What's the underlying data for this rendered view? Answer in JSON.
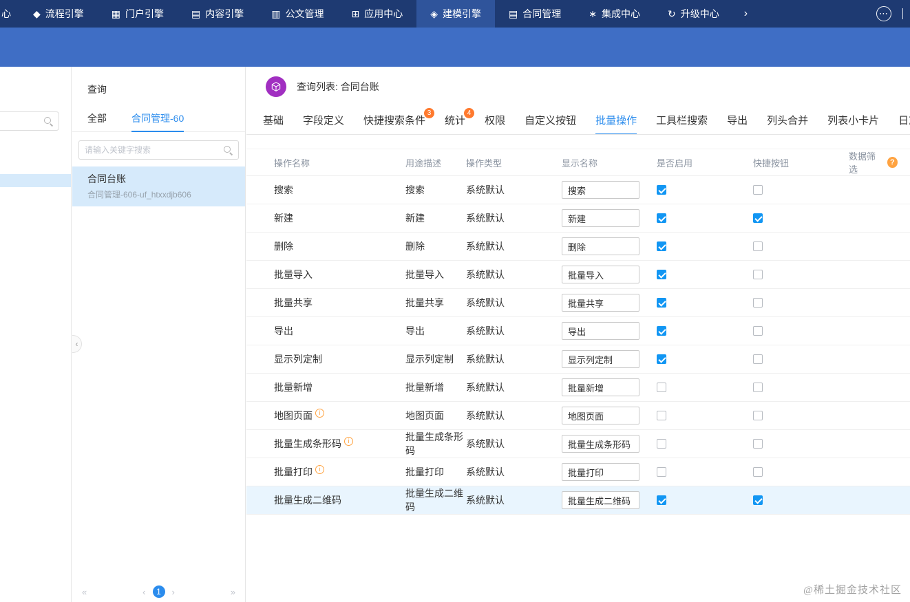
{
  "topnav": {
    "clipped_label": "心",
    "items": [
      {
        "label": "流程引擎",
        "glyph": "◆"
      },
      {
        "label": "门户引擎",
        "glyph": "▦"
      },
      {
        "label": "内容引擎",
        "glyph": "▤"
      },
      {
        "label": "公文管理",
        "glyph": "▥"
      },
      {
        "label": "应用中心",
        "glyph": "⊞"
      },
      {
        "label": "建模引擎",
        "glyph": "◈",
        "active": true
      },
      {
        "label": "合同管理",
        "glyph": "▤"
      },
      {
        "label": "集成中心",
        "glyph": "∗"
      },
      {
        "label": "升级中心",
        "glyph": "↻"
      }
    ]
  },
  "icons": {
    "chevron_right": "›",
    "more": "⋯",
    "collapse": "‹",
    "question": "?",
    "info": "i"
  },
  "colors": {
    "navbar_bg": "#1e3a72",
    "navbar_active_bg": "#2f549b",
    "subbar_bg": "#3f6ec5",
    "accent_blue": "#2b8ced",
    "checkbox_blue": "#1296f3",
    "selected_item_bg": "#d6eafb",
    "row_highlight_bg": "#e9f5fe",
    "badge_orange": "#ff7a2e",
    "info_orange": "#ffa341",
    "cube_purple": "#a12fc1"
  },
  "sidebar": {
    "title": "查询",
    "tabs": [
      {
        "label": "全部"
      },
      {
        "label": "合同管理-60",
        "active": true
      }
    ],
    "search_placeholder": "请输入关键字搜索",
    "items": [
      {
        "title": "合同台账",
        "subtitle": "合同管理-606-uf_htxxdjb606",
        "selected": true
      }
    ],
    "pagination": {
      "first": "«",
      "prev": "‹",
      "current": "1",
      "next": "›",
      "last": "»"
    }
  },
  "main": {
    "header": {
      "title": "查询列表: 合同台账"
    },
    "tabs": [
      {
        "label": "基础"
      },
      {
        "label": "字段定义"
      },
      {
        "label": "快捷搜索条件",
        "badge": "3"
      },
      {
        "label": "统计",
        "badge": "4"
      },
      {
        "label": "权限"
      },
      {
        "label": "自定义按钮"
      },
      {
        "label": "批量操作",
        "active": true
      },
      {
        "label": "工具栏搜索"
      },
      {
        "label": "导出"
      },
      {
        "label": "列头合并"
      },
      {
        "label": "列表小卡片"
      },
      {
        "label": "日志"
      }
    ],
    "table": {
      "headers": [
        "操作名称",
        "用途描述",
        "操作类型",
        "显示名称",
        "是否启用",
        "快捷按钮",
        "数据筛选"
      ],
      "rows": [
        {
          "name": "搜索",
          "desc": "搜索",
          "type": "系统默认",
          "display_name": "搜索",
          "enabled": true,
          "quick": false,
          "info": false,
          "highlighted": false
        },
        {
          "name": "新建",
          "desc": "新建",
          "type": "系统默认",
          "display_name": "新建",
          "enabled": true,
          "quick": true,
          "info": false,
          "highlighted": false
        },
        {
          "name": "删除",
          "desc": "删除",
          "type": "系统默认",
          "display_name": "删除",
          "enabled": true,
          "quick": false,
          "info": false,
          "highlighted": false
        },
        {
          "name": "批量导入",
          "desc": "批量导入",
          "type": "系统默认",
          "display_name": "批量导入",
          "enabled": true,
          "quick": false,
          "info": false,
          "highlighted": false
        },
        {
          "name": "批量共享",
          "desc": "批量共享",
          "type": "系统默认",
          "display_name": "批量共享",
          "enabled": true,
          "quick": false,
          "info": false,
          "highlighted": false
        },
        {
          "name": "导出",
          "desc": "导出",
          "type": "系统默认",
          "display_name": "导出",
          "enabled": true,
          "quick": false,
          "info": false,
          "highlighted": false
        },
        {
          "name": "显示列定制",
          "desc": "显示列定制",
          "type": "系统默认",
          "display_name": "显示列定制",
          "enabled": true,
          "quick": false,
          "info": false,
          "highlighted": false
        },
        {
          "name": "批量新增",
          "desc": "批量新增",
          "type": "系统默认",
          "display_name": "批量新增",
          "enabled": false,
          "quick": false,
          "info": false,
          "highlighted": false
        },
        {
          "name": "地图页面",
          "desc": "地图页面",
          "type": "系统默认",
          "display_name": "地图页面",
          "enabled": false,
          "quick": false,
          "info": true,
          "highlighted": false
        },
        {
          "name": "批量生成条形码",
          "desc": "批量生成条形码",
          "type": "系统默认",
          "display_name": "批量生成条形码",
          "enabled": false,
          "quick": false,
          "info": true,
          "highlighted": false
        },
        {
          "name": "批量打印",
          "desc": "批量打印",
          "type": "系统默认",
          "display_name": "批量打印",
          "enabled": false,
          "quick": false,
          "info": true,
          "highlighted": false
        },
        {
          "name": "批量生成二维码",
          "desc": "批量生成二维码",
          "type": "系统默认",
          "display_name": "批量生成二维码",
          "enabled": true,
          "quick": true,
          "info": false,
          "highlighted": true
        }
      ]
    }
  },
  "watermark": "@稀土掘金技术社区"
}
